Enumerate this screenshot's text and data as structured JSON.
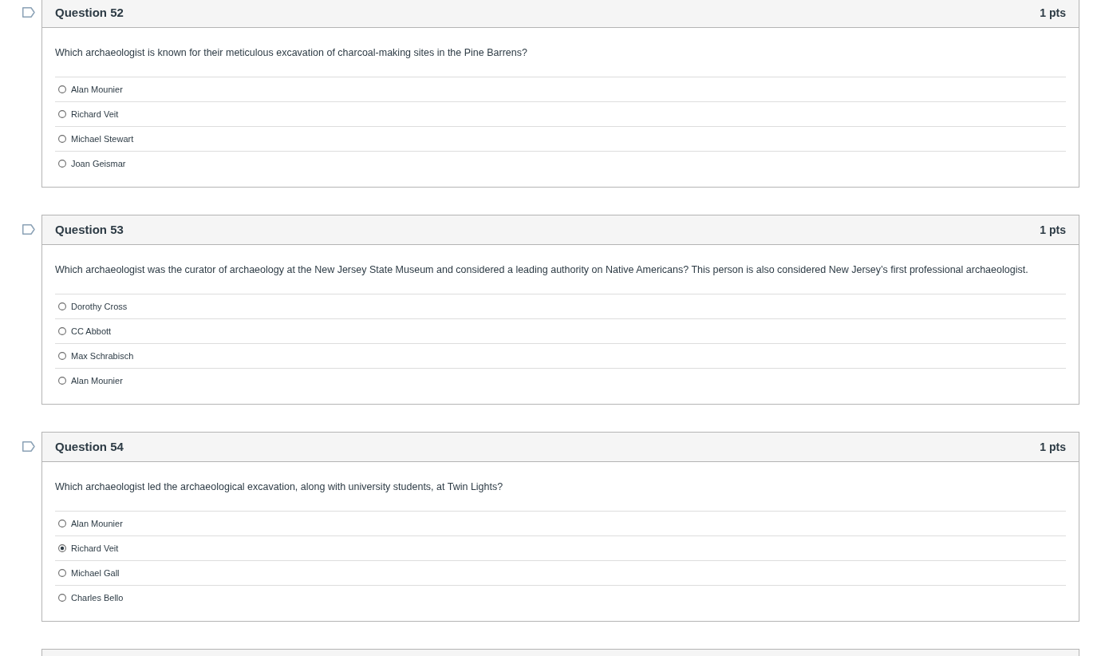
{
  "questions": [
    {
      "title": "Question 52",
      "points": "1 pts",
      "flagged": false,
      "prompt": "Which archaeologist is known for their meticulous excavation of charcoal-making sites in the Pine Barrens?",
      "options": [
        {
          "label": "Alan Mounier",
          "selected": false
        },
        {
          "label": "Richard Veit",
          "selected": false
        },
        {
          "label": "Michael Stewart",
          "selected": false
        },
        {
          "label": "Joan Geismar",
          "selected": false
        }
      ]
    },
    {
      "title": "Question 53",
      "points": "1 pts",
      "flagged": false,
      "prompt": "Which archaeologist was the curator of archaeology at the New Jersey State Museum and considered a leading authority on Native Americans? This person is also considered New Jersey’s first professional archaeologist.",
      "options": [
        {
          "label": "Dorothy Cross",
          "selected": false
        },
        {
          "label": "CC Abbott",
          "selected": false
        },
        {
          "label": "Max Schrabisch",
          "selected": false
        },
        {
          "label": "Alan Mounier",
          "selected": false
        }
      ]
    },
    {
      "title": "Question 54",
      "points": "1 pts",
      "flagged": false,
      "prompt": "Which archaeologist led the archaeological excavation, along with university students, at Twin Lights?",
      "options": [
        {
          "label": "Alan Mounier",
          "selected": false
        },
        {
          "label": "Richard Veit",
          "selected": true
        },
        {
          "label": "Michael Gall",
          "selected": false
        },
        {
          "label": "Charles Bello",
          "selected": false
        }
      ]
    }
  ]
}
